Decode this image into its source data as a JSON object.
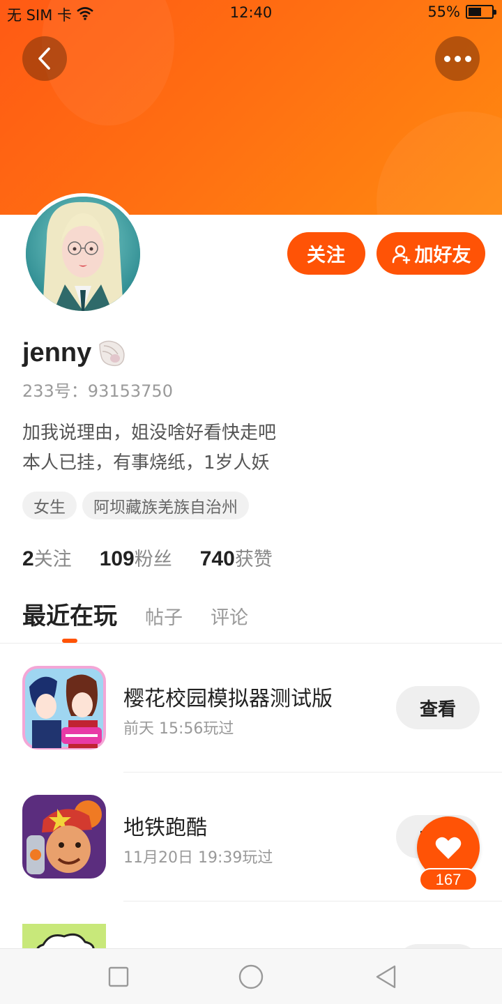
{
  "status_bar": {
    "carrier": "无 SIM 卡",
    "time": "12:40",
    "battery_percent": "55%",
    "battery_level": 0.55
  },
  "header": {
    "back_icon": "chevron-left-icon",
    "more_icon": "more-dots-icon"
  },
  "profile": {
    "follow_label": "关注",
    "add_friend_label": "加好友",
    "username": "jenny",
    "user_id": "233号：93153750",
    "bio_lines": [
      "加我说理由，姐没啥好看快走吧",
      "本人已挂，有事烧纸，1岁人妖"
    ],
    "tags": [
      "女生",
      "阿坝藏族羌族自治州"
    ],
    "stats": [
      {
        "value": "2",
        "label": "关注"
      },
      {
        "value": "109",
        "label": "粉丝"
      },
      {
        "value": "740",
        "label": "获赞"
      }
    ]
  },
  "tabs": [
    {
      "label": "最近在玩",
      "active": true
    },
    {
      "label": "帖子",
      "active": false
    },
    {
      "label": "评论",
      "active": false
    }
  ],
  "games": [
    {
      "title": "樱花校园模拟器测试版",
      "played": "前天 15:56玩过",
      "button": "查看"
    },
    {
      "title": "地铁跑酷",
      "played": "11月20日 19:39玩过",
      "button": "查看"
    },
    {
      "title": "",
      "played": "",
      "button": ""
    }
  ],
  "fab": {
    "icon": "heart-icon",
    "count": "167"
  },
  "colors": {
    "accent": "#ff5306",
    "banner_start": "#ff5a14",
    "banner_end": "#ff8a10"
  }
}
